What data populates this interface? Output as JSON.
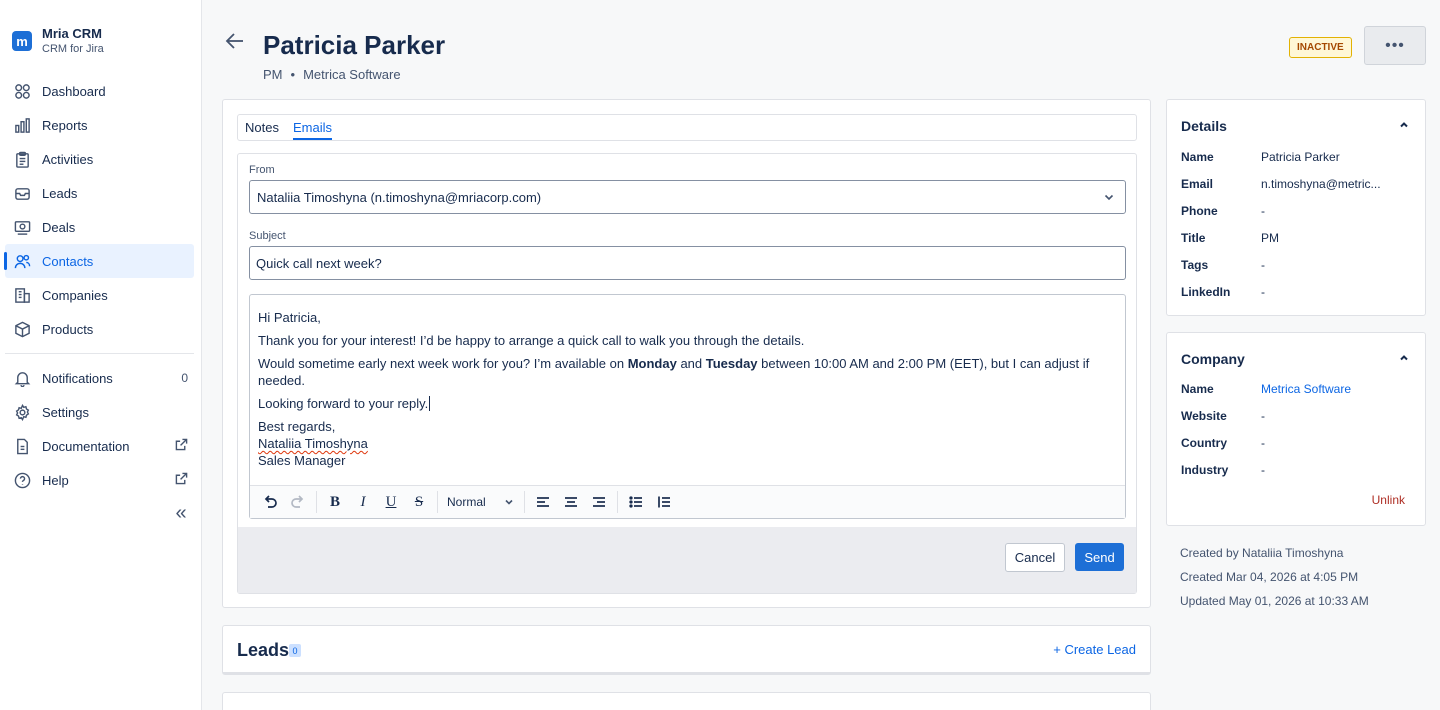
{
  "app": {
    "name": "Mria CRM",
    "subtitle": "CRM for Jira",
    "logo_letter": "m"
  },
  "sidebar": {
    "items": [
      {
        "label": "Dashboard",
        "icon": "dashboard-icon"
      },
      {
        "label": "Reports",
        "icon": "bar-chart-icon"
      },
      {
        "label": "Activities",
        "icon": "clipboard-icon"
      },
      {
        "label": "Leads",
        "icon": "inbox-icon"
      },
      {
        "label": "Deals",
        "icon": "money-icon"
      },
      {
        "label": "Contacts",
        "icon": "people-icon",
        "active": true
      },
      {
        "label": "Companies",
        "icon": "building-icon"
      },
      {
        "label": "Products",
        "icon": "box-icon"
      }
    ],
    "secondary": [
      {
        "label": "Notifications",
        "icon": "bell-icon",
        "count": "0"
      },
      {
        "label": "Settings",
        "icon": "gear-icon"
      },
      {
        "label": "Documentation",
        "icon": "document-icon",
        "external": true
      },
      {
        "label": "Help",
        "icon": "help-icon",
        "external": true
      }
    ],
    "collapse_glyph": "«"
  },
  "header": {
    "title": "Patricia Parker",
    "role": "PM",
    "separator": "•",
    "company": "Metrica Software",
    "status": "INACTIVE",
    "more_label": "•••"
  },
  "tabs": [
    {
      "label": "Notes"
    },
    {
      "label": "Emails",
      "active": true
    }
  ],
  "compose": {
    "from_label": "From",
    "from_value": "Nataliia Timoshyna (n.timoshyna@mriacorp.com)",
    "subject_label": "Subject",
    "subject_value": "Quick call next week?",
    "body": {
      "greeting": "Hi Patricia,",
      "line1": "Thank you for your interest! I’d be happy to arrange a quick call to walk you through the details.",
      "line2_pre": "Would sometime early next week work for you? I’m available on ",
      "line2_bold1": "Monday",
      "line2_mid": " and ",
      "line2_bold2": "Tuesday",
      "line2_post": " between 10:00 AM and 2:00 PM (EET), but I can adjust if needed.",
      "line3": "Looking forward to your reply.",
      "closing": "Best regards,",
      "sig_name": "Nataliia Timoshyna",
      "sig_title": "Sales Manager"
    },
    "toolbar": {
      "heading_select": "Normal",
      "bold": "B",
      "italic": "I",
      "underline": "U",
      "strike": "S"
    },
    "cancel_label": "Cancel",
    "send_label": "Send"
  },
  "leads": {
    "title": "Leads",
    "count": "0",
    "create_label": "+ Create Lead"
  },
  "details": {
    "title": "Details",
    "rows": [
      {
        "key": "Name",
        "value": "Patricia Parker"
      },
      {
        "key": "Email",
        "value": "n.timoshyna@metric..."
      },
      {
        "key": "Phone",
        "value": "-"
      },
      {
        "key": "Title",
        "value": "PM"
      },
      {
        "key": "Tags",
        "value": "-"
      },
      {
        "key": "LinkedIn",
        "value": "-"
      }
    ]
  },
  "company": {
    "title": "Company",
    "rows": [
      {
        "key": "Name",
        "value": "Metrica Software"
      },
      {
        "key": "Website",
        "value": "-"
      },
      {
        "key": "Country",
        "value": "-"
      },
      {
        "key": "Industry",
        "value": "-"
      }
    ],
    "unlink_label": "Unlink"
  },
  "meta": {
    "created_by": "Created by Nataliia Timoshyna",
    "created_at": "Created Mar 04, 2026 at 4:05 PM",
    "updated_at": "Updated May 01, 2026 at 10:33 AM"
  },
  "colors": {
    "accent": "#0c66e4",
    "primary_button": "#1d6fd6",
    "status_inactive_bg": "#fff7d6",
    "status_inactive_text": "#a54800",
    "danger_link": "#ae2e24"
  }
}
